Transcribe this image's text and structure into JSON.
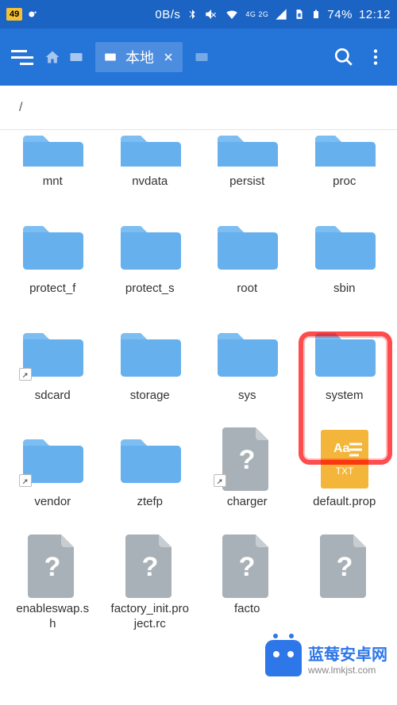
{
  "status": {
    "badge": "49",
    "net_speed": "0B/s",
    "net_label": "4G 2G",
    "battery": "74%",
    "time": "12:12"
  },
  "appbar": {
    "tab_label": "本地"
  },
  "breadcrumb": {
    "path": "/"
  },
  "items": [
    {
      "type": "folder",
      "label": "mnt",
      "partial": true
    },
    {
      "type": "folder",
      "label": "nvdata",
      "partial": true
    },
    {
      "type": "folder",
      "label": "persist",
      "partial": true
    },
    {
      "type": "folder",
      "label": "proc",
      "partial": true
    },
    {
      "type": "folder",
      "label": "protect_f"
    },
    {
      "type": "folder",
      "label": "protect_s"
    },
    {
      "type": "folder",
      "label": "root"
    },
    {
      "type": "folder",
      "label": "sbin"
    },
    {
      "type": "folder",
      "label": "sdcard",
      "link": true
    },
    {
      "type": "folder",
      "label": "storage"
    },
    {
      "type": "folder",
      "label": "sys"
    },
    {
      "type": "folder",
      "label": "system",
      "highlighted": true
    },
    {
      "type": "folder",
      "label": "vendor",
      "link": true
    },
    {
      "type": "folder",
      "label": "ztefp"
    },
    {
      "type": "unknown",
      "label": "charger",
      "link": true
    },
    {
      "type": "txt",
      "label": "default.prop"
    },
    {
      "type": "unknown",
      "label": "enableswap.sh"
    },
    {
      "type": "unknown",
      "label": "factory_init.project.rc"
    },
    {
      "type": "unknown",
      "label": "facto"
    },
    {
      "type": "unknown",
      "label": ""
    }
  ],
  "txt_badge": {
    "aa": "Aa",
    "ext": "TXT"
  },
  "watermark": {
    "title": "蓝莓安卓网",
    "url": "www.lmkjst.com"
  }
}
